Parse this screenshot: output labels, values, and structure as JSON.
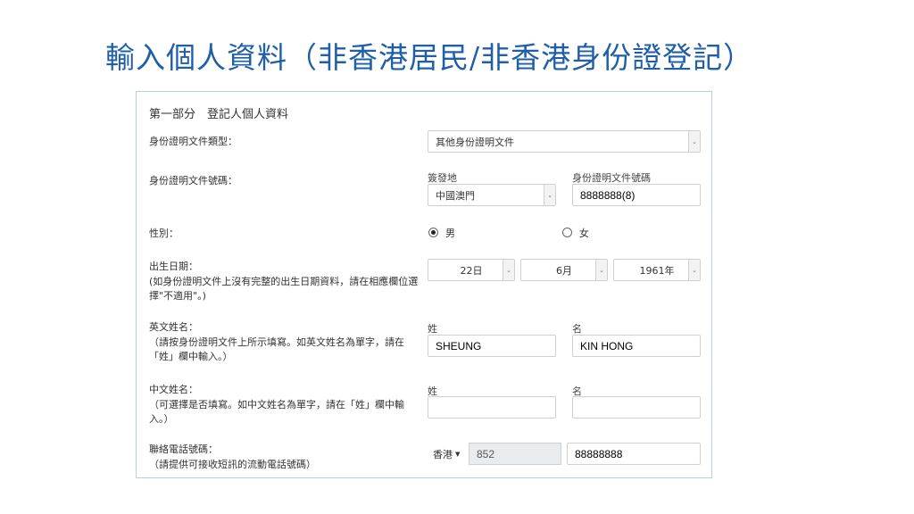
{
  "slide_title": "輸入個人資料（非香港居民/非香港身份證登記）",
  "form": {
    "section_title": "第一部分　登記人個人資料",
    "id_type": {
      "label": "身份證明文件類型：",
      "value": "其他身份證明文件"
    },
    "id_number": {
      "label": "身份證明文件號碼：",
      "issue_place_caption": "簽發地",
      "issue_place_value": "中國澳門",
      "doc_no_caption": "身份證明文件號碼",
      "doc_no_value": "8888888(8)"
    },
    "gender": {
      "label": "性別：",
      "male": "男",
      "female": "女",
      "selected": "男"
    },
    "dob": {
      "label": "出生日期：",
      "note": "(如身份證明文件上沒有完整的出生日期資料，請在相應欄位選擇\"不適用\"。)",
      "day": "22日",
      "month": "6月",
      "year": "1961年"
    },
    "english_name": {
      "label": "英文姓名：",
      "note": "（請按身份證明文件上所示填寫。如英文姓名為單字，請在「姓」欄中輸入。）",
      "surname_caption": "姓",
      "given_caption": "名",
      "surname_value": "SHEUNG",
      "given_value": "KIN HONG"
    },
    "chinese_name": {
      "label": "中文姓名：",
      "note": "（可選擇是否填寫。如中文姓名為單字，請在「姓」欄中輸入。）",
      "surname_caption": "姓",
      "given_caption": "名",
      "surname_value": "",
      "given_value": ""
    },
    "phone": {
      "label": "聯絡電話號碼：",
      "note": "（請提供可接收短訊的流動電話號碼）",
      "region": "香港",
      "country_code": "852",
      "number": "88888888"
    }
  },
  "colors": {
    "title": "#1f5fa8",
    "panel_border": "#b9cde0",
    "readonly_bg": "#e9ecef"
  }
}
